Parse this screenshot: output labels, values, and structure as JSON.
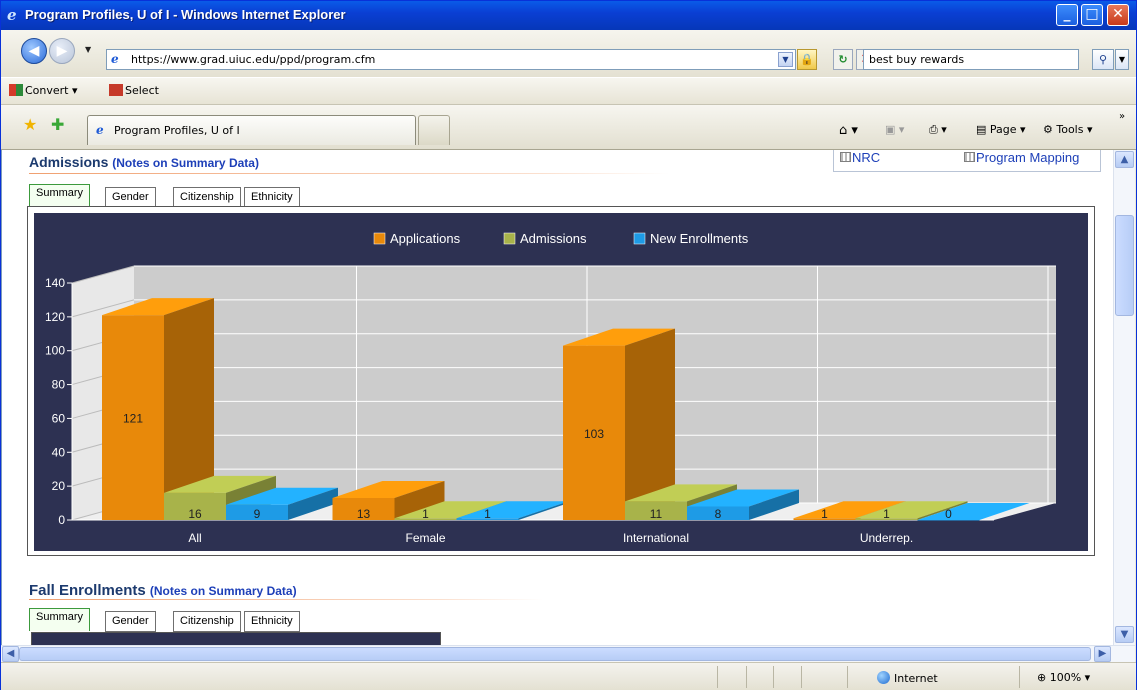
{
  "window": {
    "title": "Program Profiles, U of I - Windows Internet Explorer"
  },
  "address": {
    "url": "https://www.grad.uiuc.edu/ppd/program.cfm",
    "search_value": "best buy rewards"
  },
  "toolbar": {
    "convert": "Convert",
    "select": "Select"
  },
  "tab": {
    "label": "Program Profiles, U of I"
  },
  "commands": {
    "page": "Page",
    "tools": "Tools"
  },
  "page": {
    "admissions_title": "Admissions",
    "admissions_notes": "(Notes on Summary Data)",
    "fall_title": "Fall Enrollments",
    "fall_notes": "(Notes on Summary Data)",
    "side_links": [
      "NRC",
      "Program Mapping"
    ],
    "tabs": [
      "Summary",
      "Gender",
      "Citizenship",
      "Ethnicity"
    ]
  },
  "chart_data": {
    "type": "bar",
    "categories": [
      "All",
      "Female",
      "International",
      "Underrep."
    ],
    "series": [
      {
        "name": "Applications",
        "values": [
          121,
          13,
          103,
          1
        ],
        "color": "#e8890a"
      },
      {
        "name": "Admissions",
        "values": [
          16,
          1,
          11,
          1
        ],
        "color": "#a8b34a"
      },
      {
        "name": "New Enrollments",
        "values": [
          9,
          1,
          8,
          0
        ],
        "color": "#1e9be6"
      }
    ],
    "ylim": [
      0,
      140
    ],
    "yticks": [
      0,
      20,
      40,
      60,
      80,
      100,
      120,
      140
    ],
    "legend": "top-center",
    "grid": true
  },
  "status": {
    "zone": "Internet",
    "zoom": "100%"
  }
}
